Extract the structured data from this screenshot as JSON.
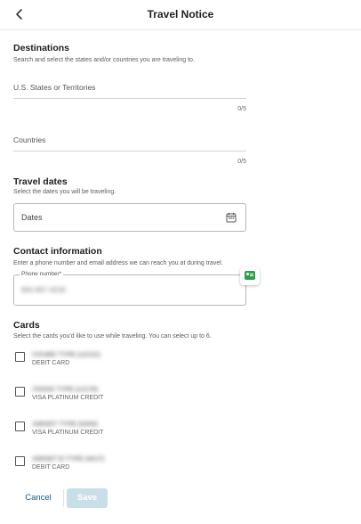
{
  "header": {
    "title": "Travel Notice"
  },
  "destinations": {
    "title": "Destinations",
    "subtitle": "Search and select the states and/or countries you are traveling to.",
    "states_placeholder": "U.S. States or Territories",
    "states_counter": "0/5",
    "countries_placeholder": "Countries",
    "countries_counter": "0/5"
  },
  "travel_dates": {
    "title": "Travel dates",
    "subtitle": "Select the dates you will be traveling.",
    "placeholder": "Dates"
  },
  "contact": {
    "title": "Contact information",
    "subtitle": "Enter a phone number and email address we can reach you at during travel.",
    "phone_label": "Phone number*",
    "phone_value": "860-867-4536"
  },
  "cards": {
    "title": "Cards",
    "subtitle": "Select the cards you'd like to use while traveling. You can select up to 6.",
    "items": [
      {
        "name": "COUBE TYPE (x2121)",
        "type": "DEBIT CARD"
      },
      {
        "name": "VISIGE TYPE (x1176)",
        "type": "VISA PLATINUM CREDIT"
      },
      {
        "name": "AMISET TYPE (0306)",
        "type": "VISA PLATINUM CREDIT"
      },
      {
        "name": "AMISET B TYPE (4217)",
        "type": "DEBIT CARD"
      }
    ]
  },
  "actions": {
    "cancel_label": "Cancel",
    "save_label": "Save"
  },
  "colors": {
    "accent": "#1a5a8c",
    "save_disabled_bg": "#c8dfe8",
    "contact_icon": "#2e9e4a"
  },
  "icons": {
    "back": "chevron-left-icon",
    "calendar": "calendar-icon",
    "contact_card": "contact-card-icon"
  }
}
